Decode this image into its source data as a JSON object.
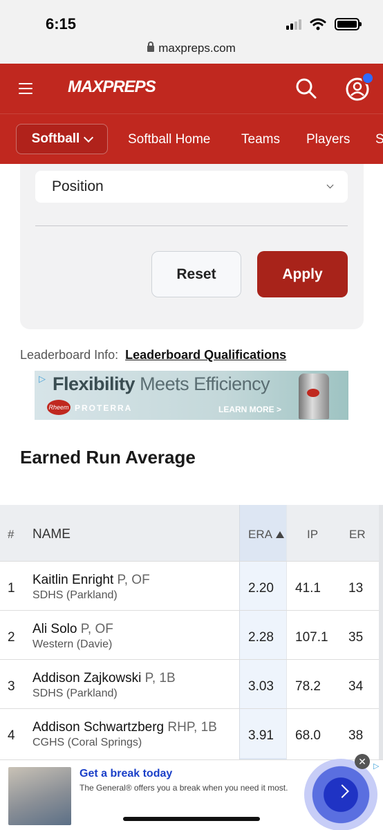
{
  "status_bar": {
    "time": "6:15",
    "url": "maxpreps.com"
  },
  "header": {
    "logo": "MAXPREPS",
    "menu_icon": "hamburger-menu-icon",
    "search_icon": "search-icon",
    "account_icon": "user-account-icon",
    "brand_color": "#c0281f"
  },
  "sport_nav": {
    "sport_selector": "Softball",
    "links": [
      "Softball Home",
      "Teams",
      "Players",
      "S"
    ]
  },
  "filters": {
    "position_select": "Position",
    "reset_label": "Reset",
    "apply_label": "Apply"
  },
  "leaderboard_info": {
    "label": "Leaderboard Info:",
    "link": "Leaderboard Qualifications"
  },
  "ad_banner": {
    "headline_bold": "Flexibility",
    "headline_rest": "Meets Efficiency",
    "brand": "Rheem",
    "product": "PROTERRA",
    "cta": "LEARN MORE >"
  },
  "section_title": "Earned Run Average",
  "table": {
    "headers": {
      "rank": "#",
      "name": "NAME",
      "era": "ERA",
      "ip": "IP",
      "er": "ER"
    },
    "sort_column": "ERA",
    "sort_direction": "ascending",
    "rows": [
      {
        "rank": "1",
        "name": "Kaitlin Enright",
        "pos": "P, OF",
        "school": "SDHS (Parkland)",
        "era": "2.20",
        "ip": "41.1",
        "er": "13"
      },
      {
        "rank": "2",
        "name": "Ali Solo",
        "pos": "P, OF",
        "school": "Western (Davie)",
        "era": "2.28",
        "ip": "107.1",
        "er": "35"
      },
      {
        "rank": "3",
        "name": "Addison Zajkowski",
        "pos": "P, 1B",
        "school": "SDHS (Parkland)",
        "era": "3.03",
        "ip": "78.2",
        "er": "34"
      },
      {
        "rank": "4",
        "name": "Addison Schwartzberg",
        "pos": "RHP, 1B",
        "school": "CGHS (Coral Springs)",
        "era": "3.91",
        "ip": "68.0",
        "er": "38"
      }
    ]
  },
  "bottom_ad": {
    "title": "Get a break today",
    "description": "The General® offers you a break when you need it most.",
    "close": "✕",
    "adchoices": "▷"
  }
}
